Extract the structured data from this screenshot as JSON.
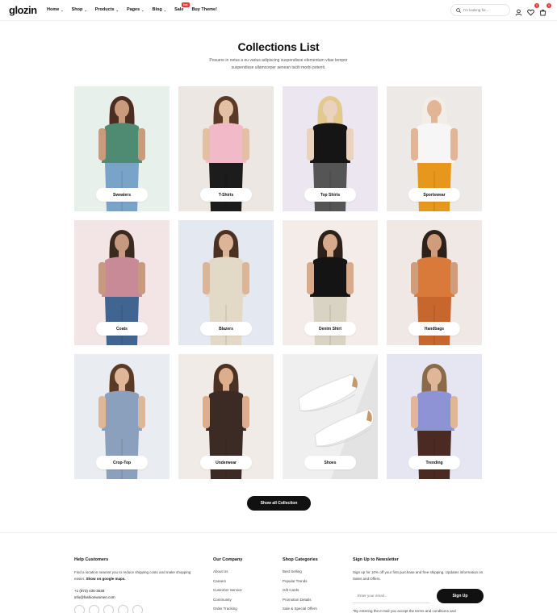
{
  "header": {
    "logo": "glozin",
    "nav": [
      {
        "label": "Home",
        "chevron": true
      },
      {
        "label": "Shop",
        "chevron": true
      },
      {
        "label": "Products",
        "chevron": true
      },
      {
        "label": "Pages",
        "chevron": true
      },
      {
        "label": "Blog",
        "chevron": true
      },
      {
        "label": "Sale",
        "chevron": false,
        "badge": "hot"
      },
      {
        "label": "Buy Theme!",
        "chevron": false
      }
    ],
    "search_placeholder": "I'm looking for...",
    "wishlist_count": "0",
    "cart_count": "0",
    "icons": [
      "search-icon",
      "user-icon",
      "heart-icon",
      "cart-icon"
    ]
  },
  "main": {
    "title": "Collections List",
    "subtitle": "Posuere in netus a eu varius adipiscing suspendisse elementum vitae tempor suspendisse ullamcorper aenean taciti morbi potenti.",
    "collections": [
      {
        "label": "Sweaters",
        "bg": "#e8f0ec",
        "top": "#4f8a73",
        "bottom": "#7aa3c9",
        "skin": "#c99a7b",
        "hair": "#4a2e22"
      },
      {
        "label": "T-Shirts",
        "bg": "#ece7e3",
        "top": "#f2b9c8",
        "bottom": "#1c1c1c",
        "skin": "#e3bfa3",
        "hair": "#5a3a26"
      },
      {
        "label": "Top Shirts",
        "bg": "#ebe6ef",
        "top": "#151515",
        "bottom": "#555555",
        "skin": "#ead2bd",
        "hair": "#e2c98c"
      },
      {
        "label": "Sportswear",
        "bg": "#ece9e6",
        "top": "#f6f6f6",
        "bottom": "#e5981c",
        "skin": "#e1b596",
        "hair": "#f2ede6"
      },
      {
        "label": "Coats",
        "bg": "#f3e5e6",
        "top": "#c98a98",
        "bottom": "#3f6590",
        "skin": "#c79a7f",
        "hair": "#3a2a20"
      },
      {
        "label": "Blazers",
        "bg": "#e4e8f0",
        "top": "#e2dac6",
        "bottom": "#e2dac6",
        "skin": "#dcb497",
        "hair": "#4a3122"
      },
      {
        "label": "Denim Shirt",
        "bg": "#f3ece8",
        "top": "#141414",
        "bottom": "#d9d3c4",
        "skin": "#d6aa8a",
        "hair": "#2e211a"
      },
      {
        "label": "Handbags",
        "bg": "#efe8e5",
        "top": "#d97a3a",
        "bottom": "#c7672e",
        "skin": "#cf9d7b",
        "hair": "#2e211a"
      },
      {
        "label": "Crop-Top",
        "bg": "#e9ecf1",
        "top": "#8aa0bd",
        "bottom": "#8aa0bd",
        "skin": "#dfb698",
        "hair": "#5a3a26"
      },
      {
        "label": "Underwear",
        "bg": "#f1ebe7",
        "top": "#3b2b24",
        "bottom": "#3b2b24",
        "skin": "#dcae8d",
        "hair": "#4a3122"
      },
      {
        "label": "Shoes",
        "bg": "#efefef",
        "top": "#ffffff",
        "bottom": "#ffffff",
        "skin": "#ffffff",
        "hair": "#ffffff"
      },
      {
        "label": "Trending",
        "bg": "#e6e6f2",
        "top": "#8d93d4",
        "bottom": "#4a2a22",
        "skin": "#dfb698",
        "hair": "#8a6a48"
      }
    ],
    "show_all_label": "Show all Collection"
  },
  "footer": {
    "help": {
      "title": "Help Customers",
      "text": "Find a location nearest you to reduce shipping costs and make shopping easier.",
      "link": "Show on google maps.",
      "phone": "+1 (973) 435-3638",
      "email": "info@fashionwomen.com"
    },
    "company": {
      "title": "Our Company",
      "links": [
        "About Us",
        "Careers",
        "Customer Service",
        "Community",
        "Order Tracking"
      ]
    },
    "categories": {
      "title": "Shop Categories",
      "links": [
        "Best Selling",
        "Popular Trends",
        "Gift Cards",
        "Promotion Details",
        "Sale & Special Offers"
      ]
    },
    "newsletter": {
      "title": "Sign Up to Newsletter",
      "text": "Sign up for 10% off your first purchase and free shipping. Updates information on Sales and Offers.",
      "placeholder": "Enter your email...",
      "button": "Sign Up",
      "note": "*By entering the e-mail you accept the terms and conditions and"
    }
  }
}
